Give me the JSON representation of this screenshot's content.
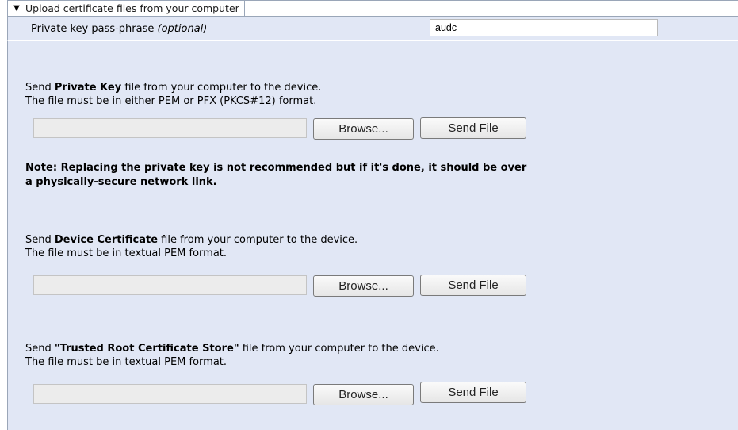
{
  "section": {
    "header_title": "Upload certificate files from your computer",
    "passphrase": {
      "label": "Private key pass-phrase",
      "optional_suffix": "(optional)",
      "value": "audc"
    }
  },
  "private_key": {
    "line1_pre": "Send ",
    "line1_bold": "Private Key",
    "line1_post": " file from your computer to the device.",
    "line2": "The file must be in either PEM or PFX (PKCS#12) format.",
    "browse_label": "Browse...",
    "send_label": "Send File",
    "note_line1": "Note: Replacing the private key is not recommended but if it's done, it should be over",
    "note_line2": "a physically-secure network link."
  },
  "device_cert": {
    "line1_pre": "Send ",
    "line1_bold": "Device Certificate",
    "line1_post": " file from your computer to the device.",
    "line2": "The file must be in textual PEM format.",
    "browse_label": "Browse...",
    "send_label": "Send File"
  },
  "trusted_root": {
    "line1_pre": "Send ",
    "line1_bold": "\"Trusted Root Certificate Store\"",
    "line1_post": " file from your computer to the device.",
    "line2": "The file must be in textual PEM format.",
    "browse_label": "Browse...",
    "send_label": "Send File"
  },
  "colors": {
    "panel_bg": "#e1e7f5",
    "border": "#9aa6b8"
  }
}
